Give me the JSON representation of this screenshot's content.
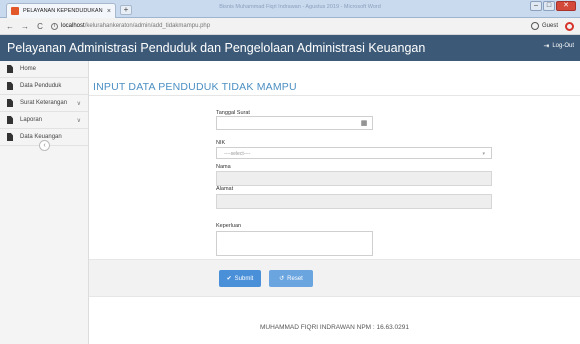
{
  "browser": {
    "tab_title": "PELAYANAN KEPENDUDUKAN",
    "tab_close": "×",
    "new_tab": "+",
    "window_title": "Bisnis Muhammad Fiqri Indrawan - Agustus 2019 - Microsoft Word",
    "url_host": "localhost",
    "url_path": "/kelurahankeraton/admin/add_tidakmampu.php",
    "profile_label": "Guest",
    "nav_back": "←",
    "nav_forward": "→",
    "nav_reload": "C",
    "win_minimize": "–",
    "win_maximize": "□",
    "win_close": "✕"
  },
  "header": {
    "title": "Pelayanan Administrasi Penduduk dan Pengelolaan Administrasi Keuangan",
    "logout_label": "Log-Out",
    "logout_icon": "⇥"
  },
  "sidebar": {
    "items": [
      {
        "label": "Home",
        "has_chevron": false
      },
      {
        "label": "Data Penduduk",
        "has_chevron": false
      },
      {
        "label": "Surat Keterangan",
        "has_chevron": true
      },
      {
        "label": "Laporan",
        "has_chevron": true
      },
      {
        "label": "Data Keuangan",
        "has_chevron": false
      }
    ],
    "chevron_glyph": "∨",
    "collapse_glyph": "‹"
  },
  "form": {
    "title": "INPUT DATA PENDUDUK TIDAK MAMPU",
    "tanggal_label": "Tanggal Surat",
    "tanggal_value": "",
    "calendar_icon": "▦",
    "nik_label": "NIK",
    "nik_selected": "----select----",
    "select_arrow": "▾",
    "nama_label": "Nama",
    "nama_value": "",
    "alamat_label": "Alamat",
    "alamat_value": "",
    "keperluan_label": "Keperluan",
    "keperluan_value": "",
    "submit_label": "Submit",
    "submit_icon": "✔",
    "reset_label": "Reset",
    "reset_icon": "↺"
  },
  "footer": {
    "text": "MUHAMMAD FIQRI INDRAWAN NPM : 16.63.0291"
  },
  "colors": {
    "header_bg": "#3c5a78",
    "title_blue": "#4b8fc3",
    "submit_bg": "#4a90d9",
    "reset_bg": "#6aa5e0"
  }
}
